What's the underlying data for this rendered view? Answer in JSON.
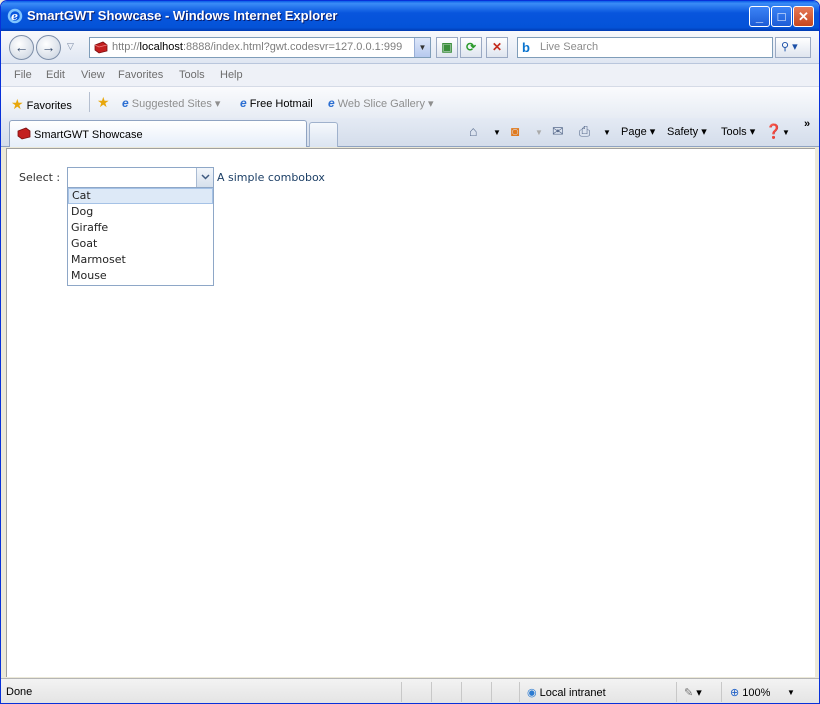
{
  "window": {
    "title": "SmartGWT Showcase - Windows Internet Explorer"
  },
  "address_bar": {
    "url_prefix": "http://",
    "url_host": "localhost",
    "url_rest": ":8888/index.html?gwt.codesvr=127.0.0.1:999"
  },
  "search": {
    "placeholder": "Live Search"
  },
  "menu": {
    "items": [
      "File",
      "Edit",
      "View",
      "Favorites",
      "Tools",
      "Help"
    ]
  },
  "favorites_bar": {
    "favorites_label": "Favorites",
    "suggested_sites": "Suggested Sites",
    "free_hotmail": "Free Hotmail",
    "web_slice_gallery": "Web Slice Gallery"
  },
  "tabs": {
    "active_tab": "SmartGWT Showcase"
  },
  "command_bar": {
    "page": "Page",
    "safety": "Safety",
    "tools": "Tools"
  },
  "form": {
    "select_label": "Select :",
    "combo_value": "",
    "combo_hint": "A simple combobox",
    "options": [
      "Cat",
      "Dog",
      "Giraffe",
      "Goat",
      "Marmoset",
      "Mouse"
    ],
    "highlighted_option": "Cat"
  },
  "status_bar": {
    "status": "Done",
    "zone": "Local intranet",
    "zoom": "100%"
  },
  "icons": {
    "app": "ie-icon",
    "back": "back-arrow-icon",
    "forward": "forward-arrow-icon",
    "refresh": "refresh-icon",
    "stop": "stop-icon",
    "search": "magnifier-icon",
    "home": "home-icon",
    "feeds": "rss-icon",
    "mail": "mail-icon",
    "print": "printer-icon",
    "help": "help-icon"
  },
  "colors": {
    "titlebar": "#0855dd",
    "highlight": "#dde9f7",
    "combo_border": "#8ea7c7"
  }
}
